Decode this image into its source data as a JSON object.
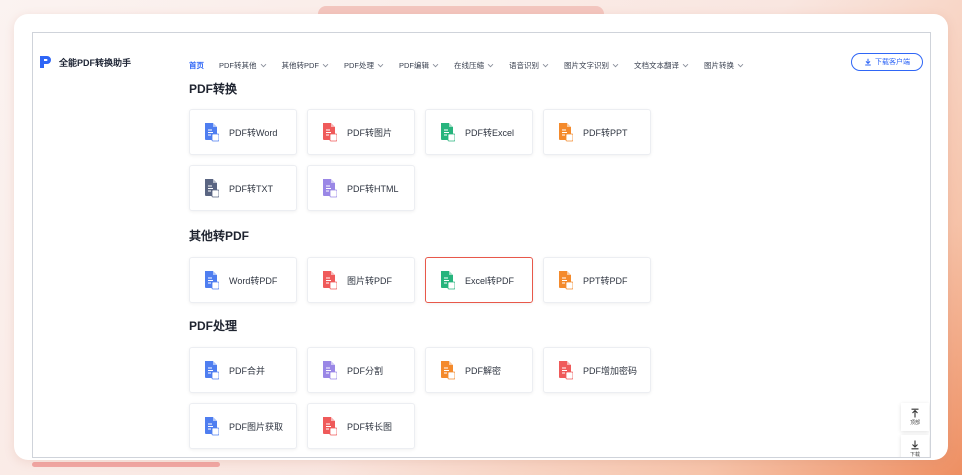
{
  "app": {
    "brand_name": "全能PDF转换助手",
    "accent": "#2f66f6"
  },
  "nav": {
    "items": [
      {
        "label": "首页",
        "active": true
      },
      {
        "label": "PDF转其他"
      },
      {
        "label": "其他转PDF"
      },
      {
        "label": "PDF处理"
      },
      {
        "label": "PDF编辑"
      },
      {
        "label": "在线压缩"
      },
      {
        "label": "语音识别"
      },
      {
        "label": "图片文字识别"
      },
      {
        "label": "文档文本翻译"
      },
      {
        "label": "图片转换"
      }
    ],
    "download_label": "下载客户端"
  },
  "sections": [
    {
      "title": "PDF转换",
      "tools": [
        {
          "label": "PDF转Word",
          "icon": "pdf-to-word-icon",
          "color": "#4f7ef0"
        },
        {
          "label": "PDF转图片",
          "icon": "pdf-to-image-icon",
          "color": "#ef5a5a"
        },
        {
          "label": "PDF转Excel",
          "icon": "pdf-to-excel-icon",
          "color": "#27b47d"
        },
        {
          "label": "PDF转PPT",
          "icon": "pdf-to-ppt-icon",
          "color": "#f48a2c"
        },
        {
          "label": "PDF转TXT",
          "icon": "pdf-to-txt-icon",
          "color": "#5a6582"
        },
        {
          "label": "PDF转HTML",
          "icon": "pdf-to-html-icon",
          "color": "#9a87e6"
        }
      ]
    },
    {
      "title": "其他转PDF",
      "tools": [
        {
          "label": "Word转PDF",
          "icon": "word-to-pdf-icon",
          "color": "#4f7ef0"
        },
        {
          "label": "图片转PDF",
          "icon": "image-to-pdf-icon",
          "color": "#ef5a5a"
        },
        {
          "label": "Excel转PDF",
          "icon": "excel-to-pdf-icon",
          "color": "#27b47d",
          "selected": true
        },
        {
          "label": "PPT转PDF",
          "icon": "ppt-to-pdf-icon",
          "color": "#f48a2c"
        }
      ]
    },
    {
      "title": "PDF处理",
      "tools": [
        {
          "label": "PDF合并",
          "icon": "pdf-merge-icon",
          "color": "#4f7ef0"
        },
        {
          "label": "PDF分割",
          "icon": "pdf-split-icon",
          "color": "#9a87e6"
        },
        {
          "label": "PDF解密",
          "icon": "pdf-decrypt-icon",
          "color": "#f48a2c"
        },
        {
          "label": "PDF增加密码",
          "icon": "pdf-add-password-icon",
          "color": "#ef5a5a"
        },
        {
          "label": "PDF图片获取",
          "icon": "pdf-extract-images-icon",
          "color": "#4f7ef0"
        },
        {
          "label": "PDF转长图",
          "icon": "pdf-to-long-image-icon",
          "color": "#ef5a5a"
        }
      ]
    }
  ],
  "float_buttons": {
    "top_label": "顶部",
    "bottom_label": "下载"
  }
}
